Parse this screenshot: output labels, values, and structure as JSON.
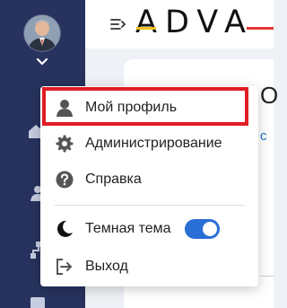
{
  "header": {
    "logo_text": "ADVA"
  },
  "user_menu": {
    "items": [
      {
        "label": "Мой профиль",
        "icon": "user-icon"
      },
      {
        "label": "Администрирование",
        "icon": "gear-icon"
      },
      {
        "label": "Справка",
        "icon": "help-circle-icon"
      }
    ],
    "dark_theme": {
      "label": "Темная тема",
      "icon": "moon-icon",
      "enabled": true
    },
    "logout": {
      "label": "Выход",
      "icon": "logout-icon"
    }
  },
  "background_card": {
    "heading_fragment": "О",
    "link_fragment": "с"
  },
  "colors": {
    "sidebar": "#27335e",
    "accent_blue": "#2a6fd6",
    "highlight_red": "#e01c24",
    "logo_red": "#e53935",
    "logo_yellow": "#f0c020"
  }
}
